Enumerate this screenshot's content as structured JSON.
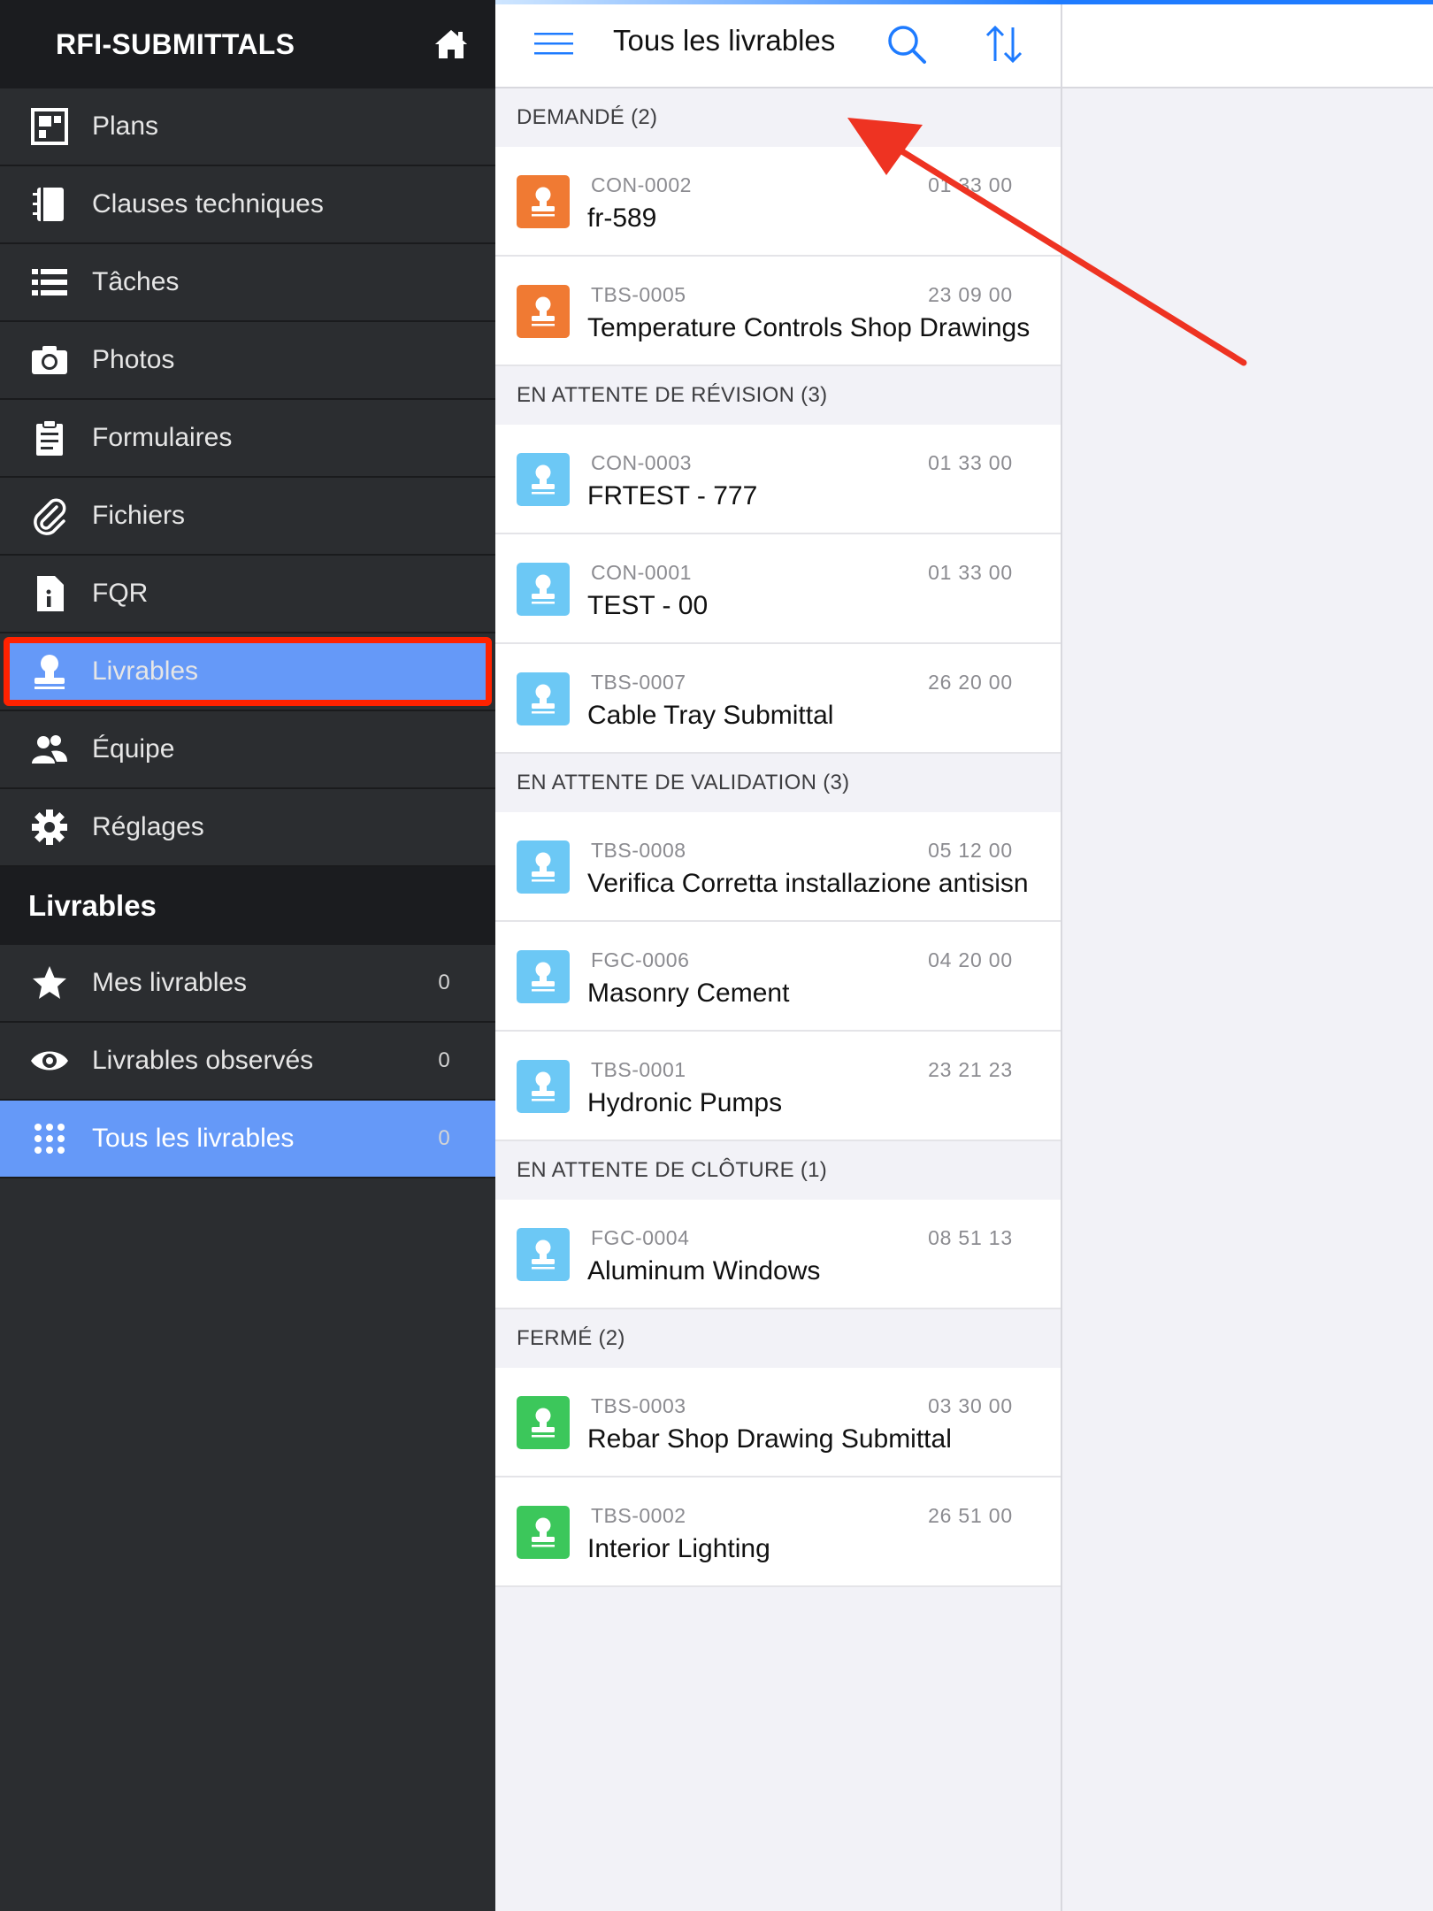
{
  "sidebar": {
    "app_title": "RFI-SUBMITTALS",
    "items": [
      {
        "label": "Plans",
        "icon": "plans-icon"
      },
      {
        "label": "Clauses techniques",
        "icon": "notebook-icon"
      },
      {
        "label": "Tâches",
        "icon": "list-icon"
      },
      {
        "label": "Photos",
        "icon": "camera-icon"
      },
      {
        "label": "Formulaires",
        "icon": "clipboard-icon"
      },
      {
        "label": "Fichiers",
        "icon": "paperclip-icon"
      },
      {
        "label": "FQR",
        "icon": "info-document-icon"
      },
      {
        "label": "Livrables",
        "icon": "stamp-icon",
        "selected": true
      },
      {
        "label": "Équipe",
        "icon": "team-icon"
      },
      {
        "label": "Réglages",
        "icon": "gear-icon"
      }
    ],
    "section_title": "Livrables",
    "sub_items": [
      {
        "label": "Mes livrables",
        "count": "0",
        "icon": "star-icon"
      },
      {
        "label": "Livrables observés",
        "count": "0",
        "icon": "eye-icon"
      },
      {
        "label": "Tous les livrables",
        "count": "0",
        "icon": "grid-dots-icon",
        "selected": true
      }
    ]
  },
  "header": {
    "title": "Tous les livrables"
  },
  "groups": [
    {
      "title": "DEMANDÉ (2)",
      "color": "#f07a33",
      "rows": [
        {
          "code": "CON-0002",
          "date": "01 33 00",
          "name": "fr-589"
        },
        {
          "code": "TBS-0005",
          "date": "23 09 00",
          "name": "Temperature Controls Shop Drawings"
        }
      ]
    },
    {
      "title": "EN ATTENTE DE RÉVISION (3)",
      "color": "#6cc8f5",
      "rows": [
        {
          "code": "CON-0003",
          "date": "01 33 00",
          "name": "FRTEST - 777"
        },
        {
          "code": "CON-0001",
          "date": "01 33 00",
          "name": "TEST - 00"
        },
        {
          "code": "TBS-0007",
          "date": "26 20 00",
          "name": "Cable Tray Submittal"
        }
      ]
    },
    {
      "title": "EN ATTENTE DE VALIDATION (3)",
      "color": "#6cc8f5",
      "rows": [
        {
          "code": "TBS-0008",
          "date": "05 12 00",
          "name": "Verifica Corretta installazione antisisn"
        },
        {
          "code": "FGC-0006",
          "date": "04 20 00",
          "name": "Masonry Cement"
        },
        {
          "code": "TBS-0001",
          "date": "23 21 23",
          "name": "Hydronic Pumps"
        }
      ]
    },
    {
      "title": "EN ATTENTE DE CLÔTURE (1)",
      "color": "#6cc8f5",
      "rows": [
        {
          "code": "FGC-0004",
          "date": "08 51 13",
          "name": "Aluminum Windows"
        }
      ]
    },
    {
      "title": "FERMÉ (2)",
      "color": "#3cc75b",
      "rows": [
        {
          "code": "TBS-0003",
          "date": "03 30 00",
          "name": "Rebar Shop Drawing Submittal"
        },
        {
          "code": "TBS-0002",
          "date": "26 51 00",
          "name": "Interior Lighting"
        }
      ]
    }
  ],
  "colors": {
    "accent": "#6599f8",
    "highlight_box": "#ff2200",
    "annotation_arrow": "#ee3322",
    "icon_blue": "#1e7bff"
  }
}
